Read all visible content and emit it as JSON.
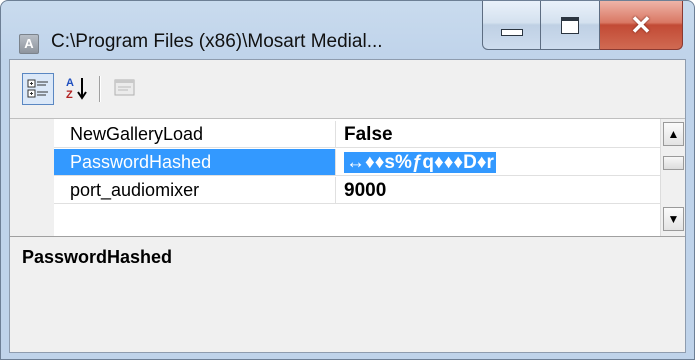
{
  "window": {
    "title": "C:\\Program Files (x86)\\Mosart Medial...",
    "app_icon_letter": "A"
  },
  "toolbar": {
    "categorized_icon": "categorized-view-icon",
    "alphabetical_icon": "alphabetical-sort-icon",
    "property_pages_icon": "property-pages-icon"
  },
  "grid": {
    "rows": [
      {
        "name": "NewGalleryLoad",
        "value": "False"
      },
      {
        "name": "PasswordHashed",
        "value": "↔♦♦s%ƒq♦♦♦D♦r"
      },
      {
        "name": "port_audiomixer",
        "value": "9000"
      }
    ]
  },
  "description": {
    "title": "PasswordHashed"
  },
  "colors": {
    "selection": "#3399ff",
    "close_button": "#c24a35"
  }
}
